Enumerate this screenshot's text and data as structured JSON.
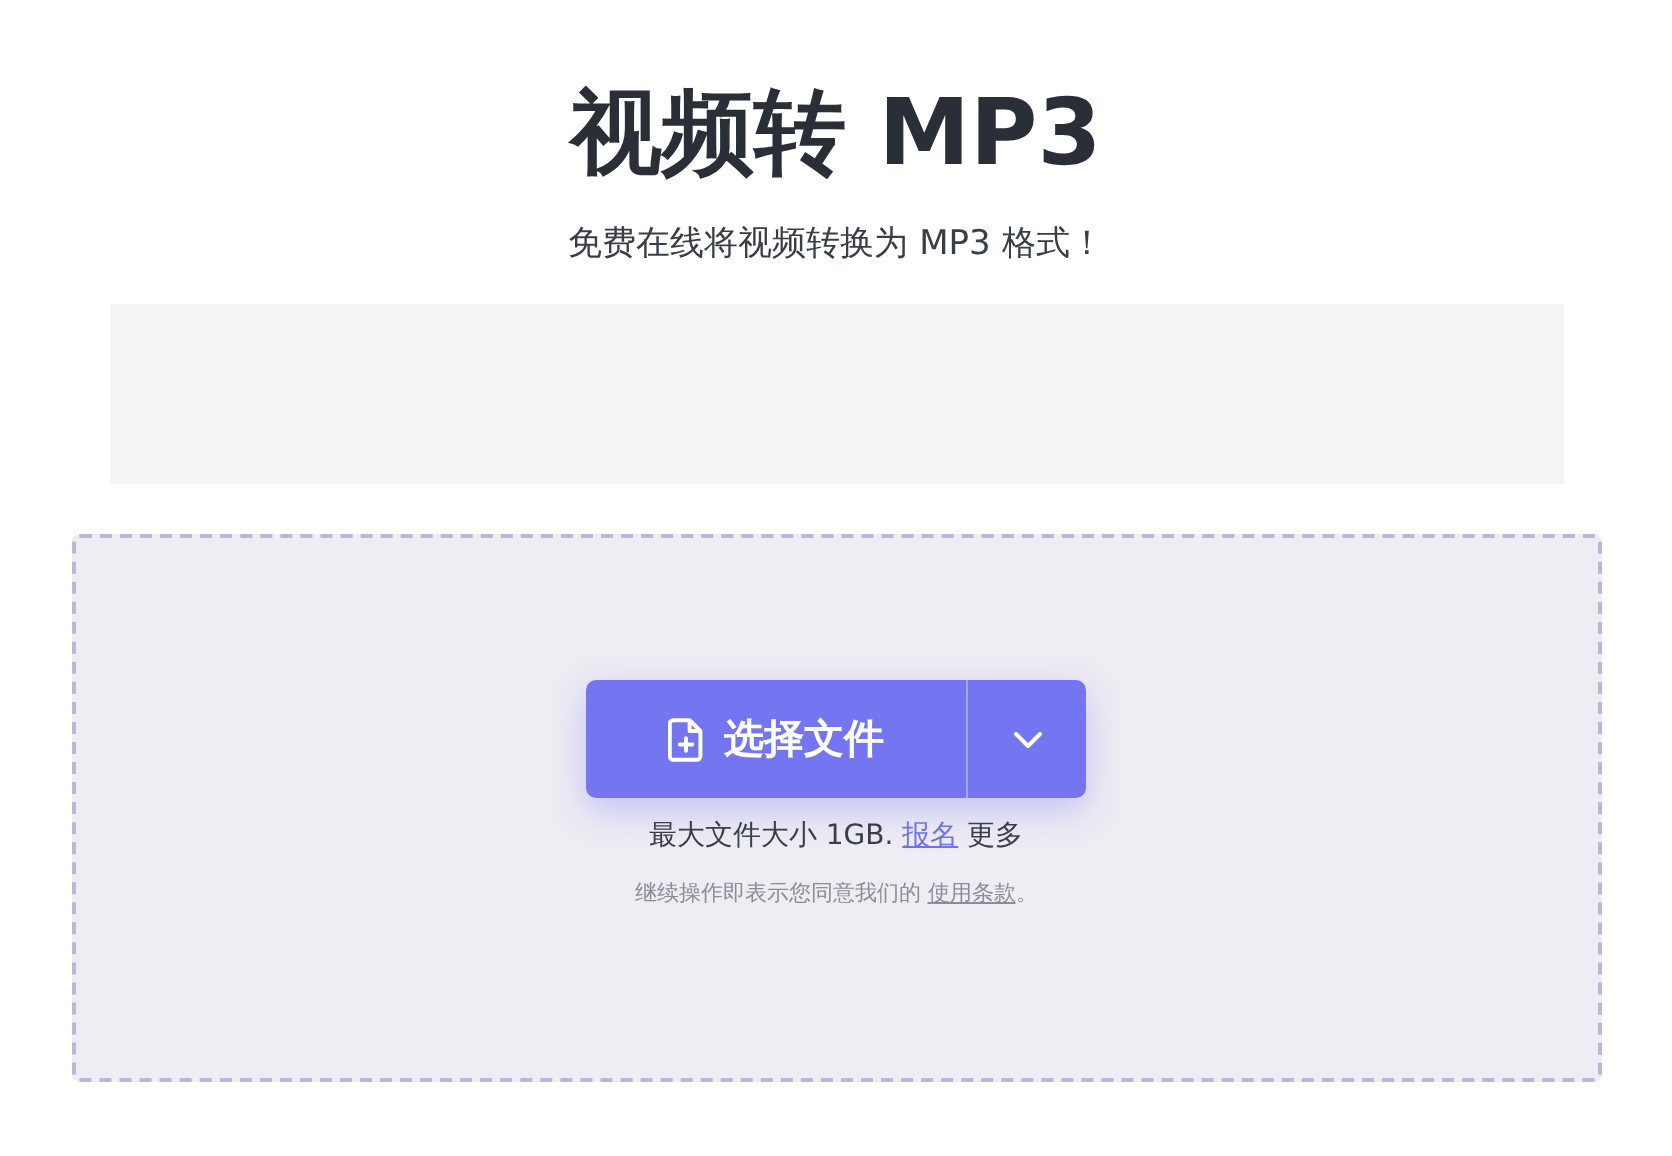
{
  "header": {
    "title": "视频转 MP3",
    "subtitle": "免费在线将视频转换为 MP3 格式！"
  },
  "ad_slot": {
    "kind": "blank"
  },
  "upload": {
    "button": "选择文件",
    "size_note": {
      "text": "最大文件大小 1GB.",
      "link": "报名",
      "after": "更多"
    },
    "terms_note": {
      "text": "继续操作即表示您同意我们的",
      "link": "使用条款",
      "after": "。"
    }
  }
}
